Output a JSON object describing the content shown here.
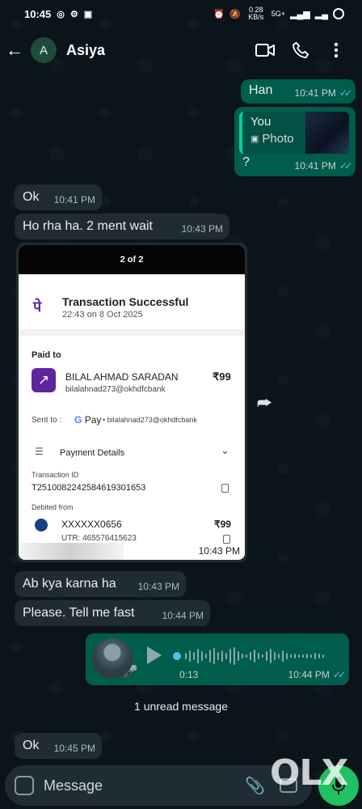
{
  "status_bar": {
    "time": "10:45",
    "network_speed": "0.28 KB/s",
    "network_type": "5G+"
  },
  "header": {
    "avatar_letter": "A",
    "contact_name": "Asiya",
    "icons": [
      "back-arrow-icon",
      "video-call-icon",
      "voice-call-icon",
      "more-options-icon"
    ]
  },
  "messages": [
    {
      "dir": "out",
      "text": "Han",
      "time": "10:41 PM"
    },
    {
      "dir": "out",
      "reply_author": "You",
      "reply_kind": "Photo",
      "text": "?",
      "time": "10:41 PM"
    },
    {
      "dir": "in",
      "text": "Ok",
      "time": "10:41 PM"
    },
    {
      "dir": "in",
      "text": "Ho rha ha.  2 ment wait",
      "time": "10:43 PM"
    },
    {
      "dir": "in",
      "type": "image",
      "time": "10:43 PM"
    },
    {
      "dir": "in",
      "text": "Ab kya karna ha",
      "time": "10:43 PM"
    },
    {
      "dir": "in",
      "text": "Please.  Tell me fast",
      "time": "10:44 PM"
    },
    {
      "dir": "out",
      "type": "voice",
      "duration": "0:13",
      "time": "10:44 PM"
    },
    {
      "dir": "in",
      "text": "Ok",
      "time": "10:45 PM"
    }
  ],
  "receipt": {
    "page_indicator": "2 of 2",
    "status_title": "Transaction Successful",
    "status_time": "22:43 on 8 Oct 2025",
    "paid_to_label": "Paid to",
    "payee_name": "BILAL AHMAD SARADAN",
    "payee_upi": "bilalahnad273@okhdfcbank",
    "amount": "₹99",
    "sent_to_label": "Sent to :",
    "sent_via": "Pay",
    "sent_upi": "• bilalahnad273@okhdfcbank",
    "payment_details_label": "Payment Details",
    "txn_id_label": "Transaction ID",
    "txn_id": "T2510082242584619301653",
    "debited_from_label": "Debited from",
    "debit_account": "XXXXXX0656",
    "debit_amount": "₹99",
    "utr": "UTR: 465576415623"
  },
  "unread_banner": "1 unread message",
  "composer": {
    "placeholder": "Message"
  },
  "watermark": "OLX",
  "colors": {
    "background": "#0b141a",
    "incoming_bubble": "#202c33",
    "outgoing_bubble": "#005c4b",
    "read_ticks": "#53bdeb",
    "mic_button": "#21c063",
    "phonepe": "#5f259f"
  }
}
